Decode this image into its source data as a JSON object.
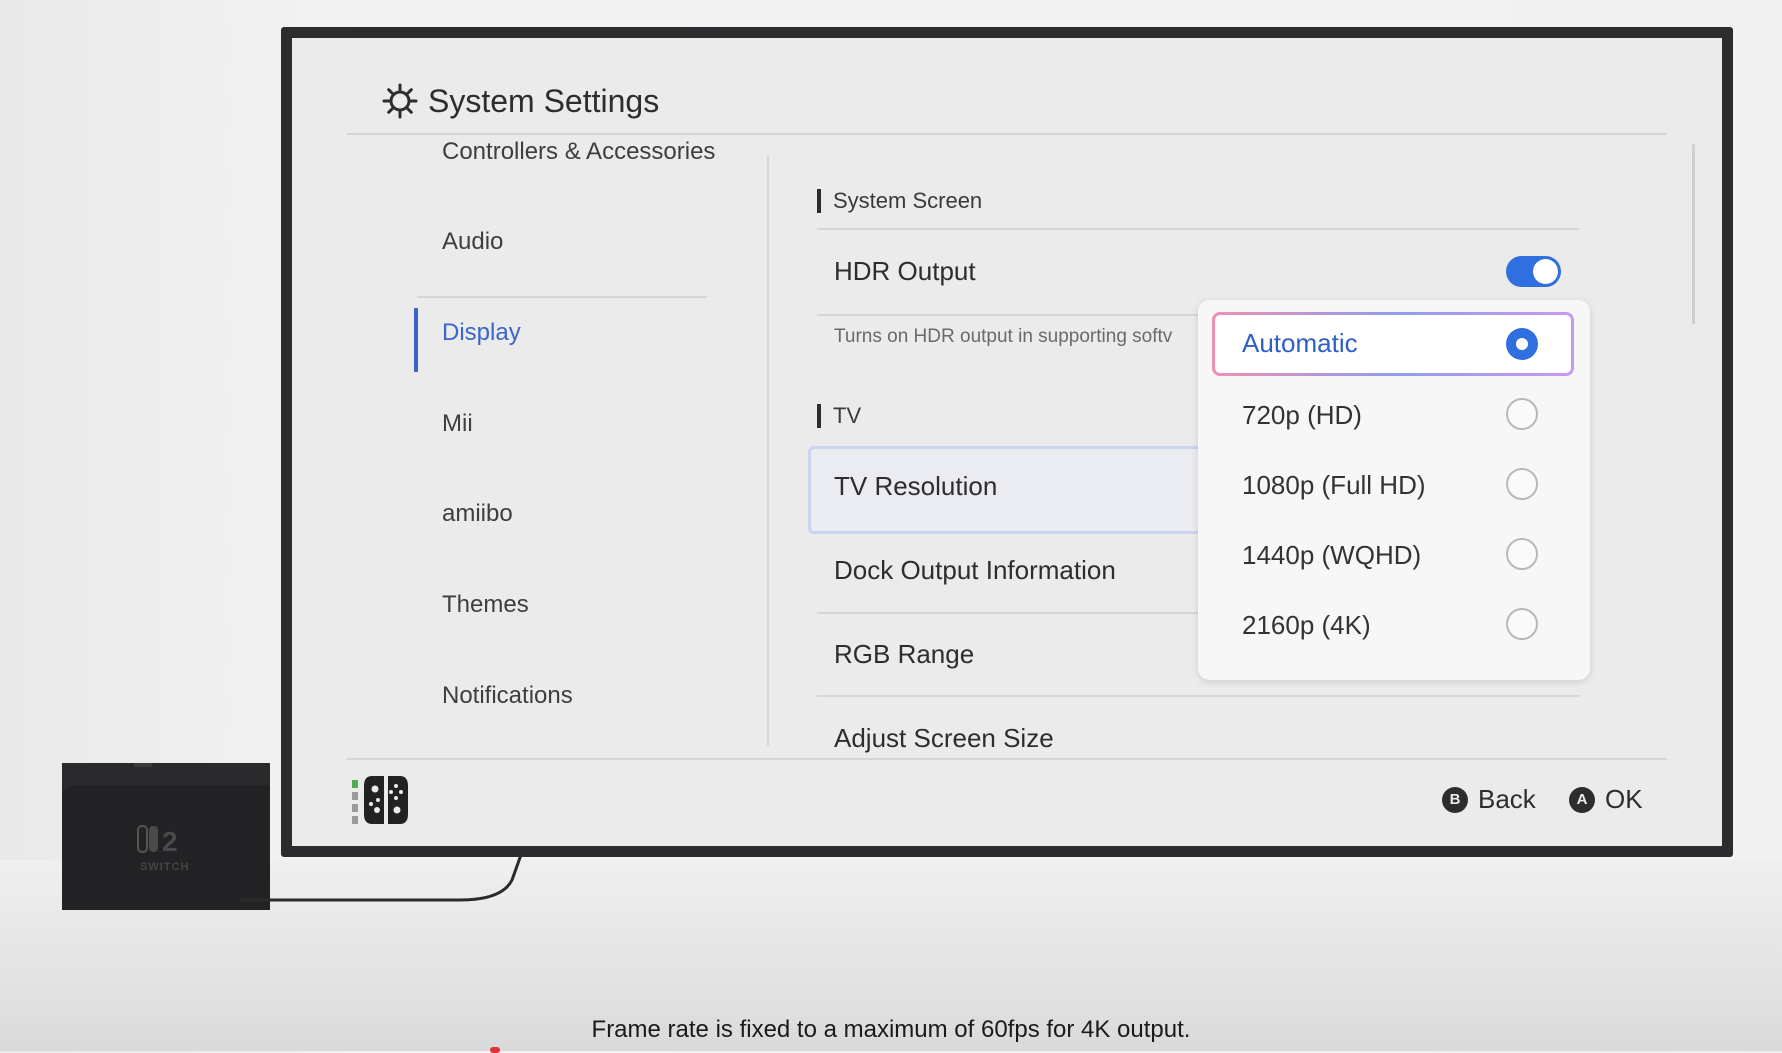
{
  "header": {
    "title": "System Settings",
    "icon": "gear-icon"
  },
  "sidebar": {
    "items": [
      {
        "label": "Controllers & Accessories"
      },
      {
        "label": "Audio"
      },
      {
        "label": "Display",
        "active": true
      },
      {
        "label": "Mii"
      },
      {
        "label": "amiibo"
      },
      {
        "label": "Themes"
      },
      {
        "label": "Notifications"
      }
    ]
  },
  "main": {
    "system_screen_heading": "System Screen",
    "hdr_label": "HDR Output",
    "hdr_enabled": true,
    "hdr_hint": "Turns on HDR output in supporting softv",
    "tv_heading": "TV",
    "tv_resolution_label": "TV Resolution",
    "dock_output_label": "Dock Output Information",
    "rgb_range_label": "RGB Range",
    "adjust_screen_label": "Adjust Screen Size"
  },
  "resolution_dropdown": {
    "selected": "Automatic",
    "options": [
      {
        "label": "Automatic",
        "selected": true
      },
      {
        "label": "720p (HD)",
        "selected": false
      },
      {
        "label": "1080p (Full HD)",
        "selected": false
      },
      {
        "label": "1440p (WQHD)",
        "selected": false
      },
      {
        "label": "2160p (4K)",
        "selected": false
      }
    ]
  },
  "footer": {
    "back_key": "B",
    "back_label": "Back",
    "ok_key": "A",
    "ok_label": "OK"
  },
  "dock": {
    "logo_text": "2",
    "brand_text": "SWITCH"
  },
  "caption": "Frame rate is fixed to a maximum of 60fps for 4K output.",
  "colors": {
    "accent": "#3a66c7",
    "toggle_on": "#2f6fe0",
    "screen_bg": "#ebebeb"
  }
}
